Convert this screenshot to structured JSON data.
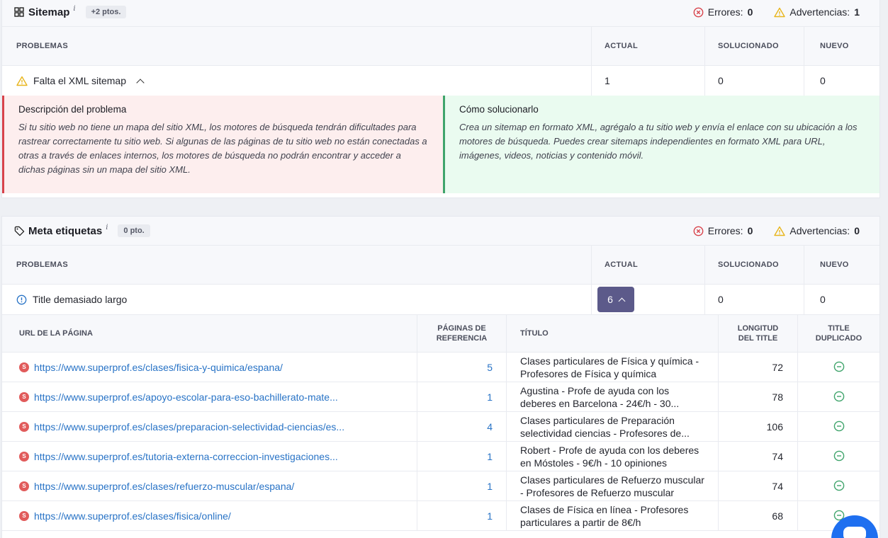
{
  "sitemap": {
    "title": "Sitemap",
    "info": "i",
    "points": "+2 ptos.",
    "errors_label": "Errores:",
    "errors": "0",
    "warnings_label": "Advertencias:",
    "warnings": "1",
    "columns": [
      "PROBLEMAS",
      "ACTUAL",
      "SOLUCIONADO",
      "NUEVO"
    ],
    "issue": {
      "label": "Falta el XML sitemap",
      "actual": "1",
      "solved": "0",
      "new": "0"
    },
    "description_title": "Descripción del problema",
    "description": "Si tu sitio web no tiene un mapa del sitio XML, los motores de búsqueda tendrán dificultades para rastrear correctamente tu sitio web. Si algunas de las páginas de tu sitio web no están conectadas a otras a través de enlaces internos, los motores de búsqueda no podrán encontrar y acceder a dichas páginas sin un mapa del sitio XML.",
    "fix_title": "Cómo solucionarlo",
    "fix": "Crea un sitemap en formato XML, agrégalo a tu sitio web y envía el enlace con su ubicación a los motores de búsqueda. Puedes crear sitemaps independientes en formato XML para URL, imágenes, videos, noticias y contenido móvil."
  },
  "meta": {
    "title": "Meta etiquetas",
    "info": "i",
    "points": "0 pto.",
    "errors_label": "Errores:",
    "errors": "0",
    "warnings_label": "Advertencias:",
    "warnings": "0",
    "columns": [
      "PROBLEMAS",
      "ACTUAL",
      "SOLUCIONADO",
      "NUEVO"
    ],
    "issue": {
      "label": "Title demasiado largo",
      "actual": "6",
      "solved": "0",
      "new": "0"
    },
    "sub_columns": {
      "url": "URL DE LA PÁGINA",
      "ref_1": "PÁGINAS DE",
      "ref_2": "REFERENCIA",
      "title": "TÍTULO",
      "len_1": "LONGITUD",
      "len_2": "DEL TITLE",
      "dup_1": "TITLE",
      "dup_2": "DUPLICADO"
    },
    "rows": [
      {
        "url": "https://www.superprof.es/clases/fisica-y-quimica/espana/",
        "refs": "5",
        "title_1": "Clases particulares de Física y química -",
        "title_2": "Profesores de Física y química",
        "length": "72"
      },
      {
        "url": "https://www.superprof.es/apoyo-escolar-para-eso-bachillerato-mate...",
        "refs": "1",
        "title_1": "Agustina - Profe de ayuda con los",
        "title_2": "deberes en Barcelona - 24€/h - 30...",
        "length": "78"
      },
      {
        "url": "https://www.superprof.es/clases/preparacion-selectividad-ciencias/es...",
        "refs": "4",
        "title_1": "Clases particulares de Preparación",
        "title_2": "selectividad ciencias - Profesores de...",
        "length": "106"
      },
      {
        "url": "https://www.superprof.es/tutoria-externa-correccion-investigaciones...",
        "refs": "1",
        "title_1": "Robert - Profe de ayuda con los deberes",
        "title_2": "en Móstoles - 9€/h - 10 opiniones",
        "length": "74"
      },
      {
        "url": "https://www.superprof.es/clases/refuerzo-muscular/espana/",
        "refs": "1",
        "title_1": "Clases particulares de Refuerzo muscular",
        "title_2": "- Profesores de Refuerzo muscular",
        "length": "74"
      },
      {
        "url": "https://www.superprof.es/clases/fisica/online/",
        "refs": "1",
        "title_1": "Clases de Física en línea - Profesores",
        "title_2": "particulares a partir de 8€/h",
        "length": "68"
      }
    ]
  },
  "colors": {
    "accent": "#5c5a8a",
    "link": "#2873c6",
    "error": "#d8434b",
    "warning": "#e8b51c",
    "ok": "#3fa46b"
  }
}
